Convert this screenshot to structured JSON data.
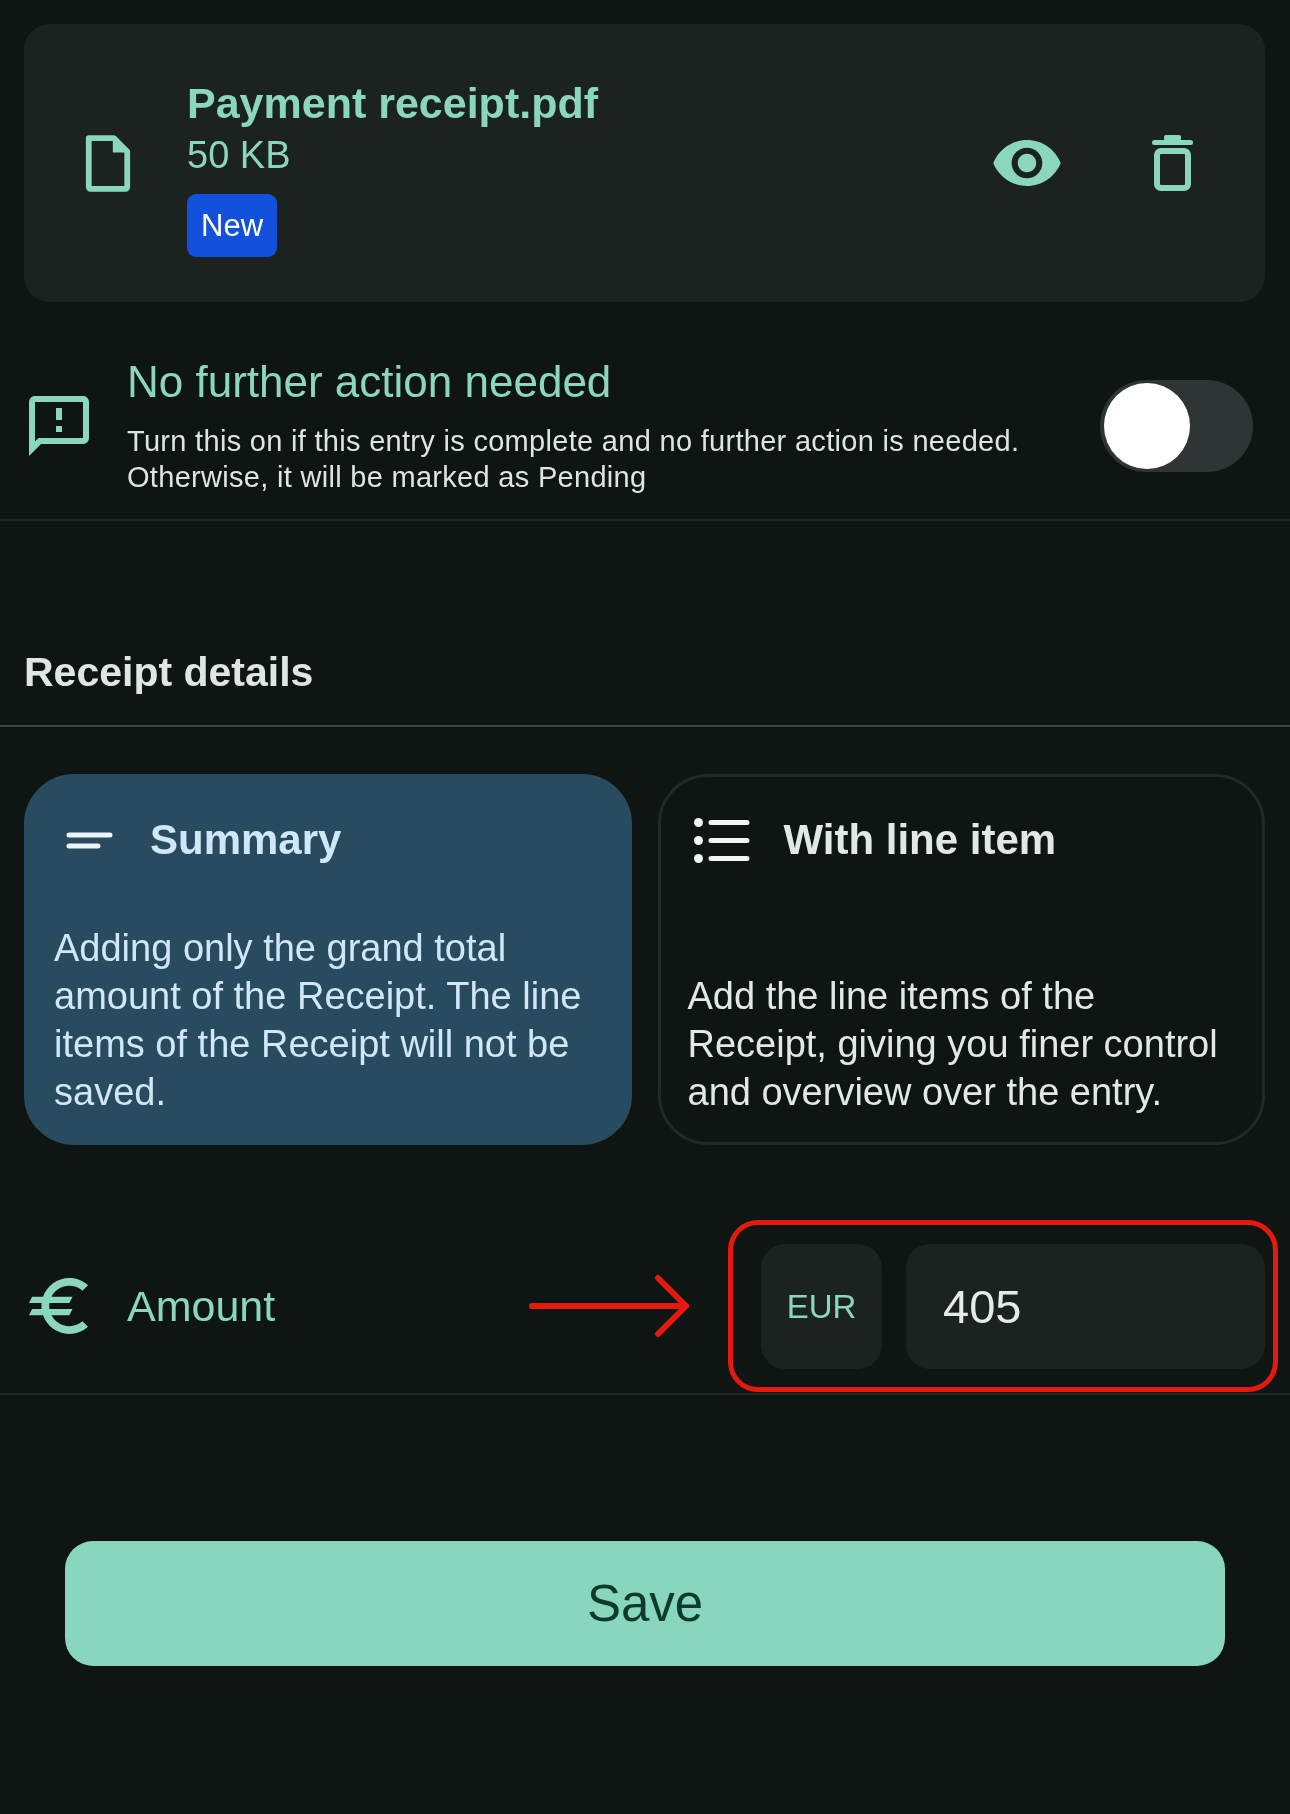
{
  "file": {
    "name": "Payment receipt.pdf",
    "size": "50 KB",
    "badge": "New"
  },
  "completion": {
    "title": "No further action needed",
    "description": "Turn this on if this entry is complete and no further action is needed. Otherwise, it will be marked as Pending",
    "on": false
  },
  "receipt_details": {
    "heading": "Receipt details",
    "modes": [
      {
        "kind": "summary",
        "title": "Summary",
        "description": "Adding only the grand total amount of the Receipt. The line items of the Receipt will not be saved.",
        "selected": true
      },
      {
        "kind": "line_items",
        "title": "With line item",
        "description": "Add the line items of the Receipt, giving you finer control and overview over the entry.",
        "selected": false
      }
    ]
  },
  "amount": {
    "label": "Amount",
    "currency": "EUR",
    "value": "405",
    "highlighted": true
  },
  "save_button": {
    "label": "Save"
  }
}
